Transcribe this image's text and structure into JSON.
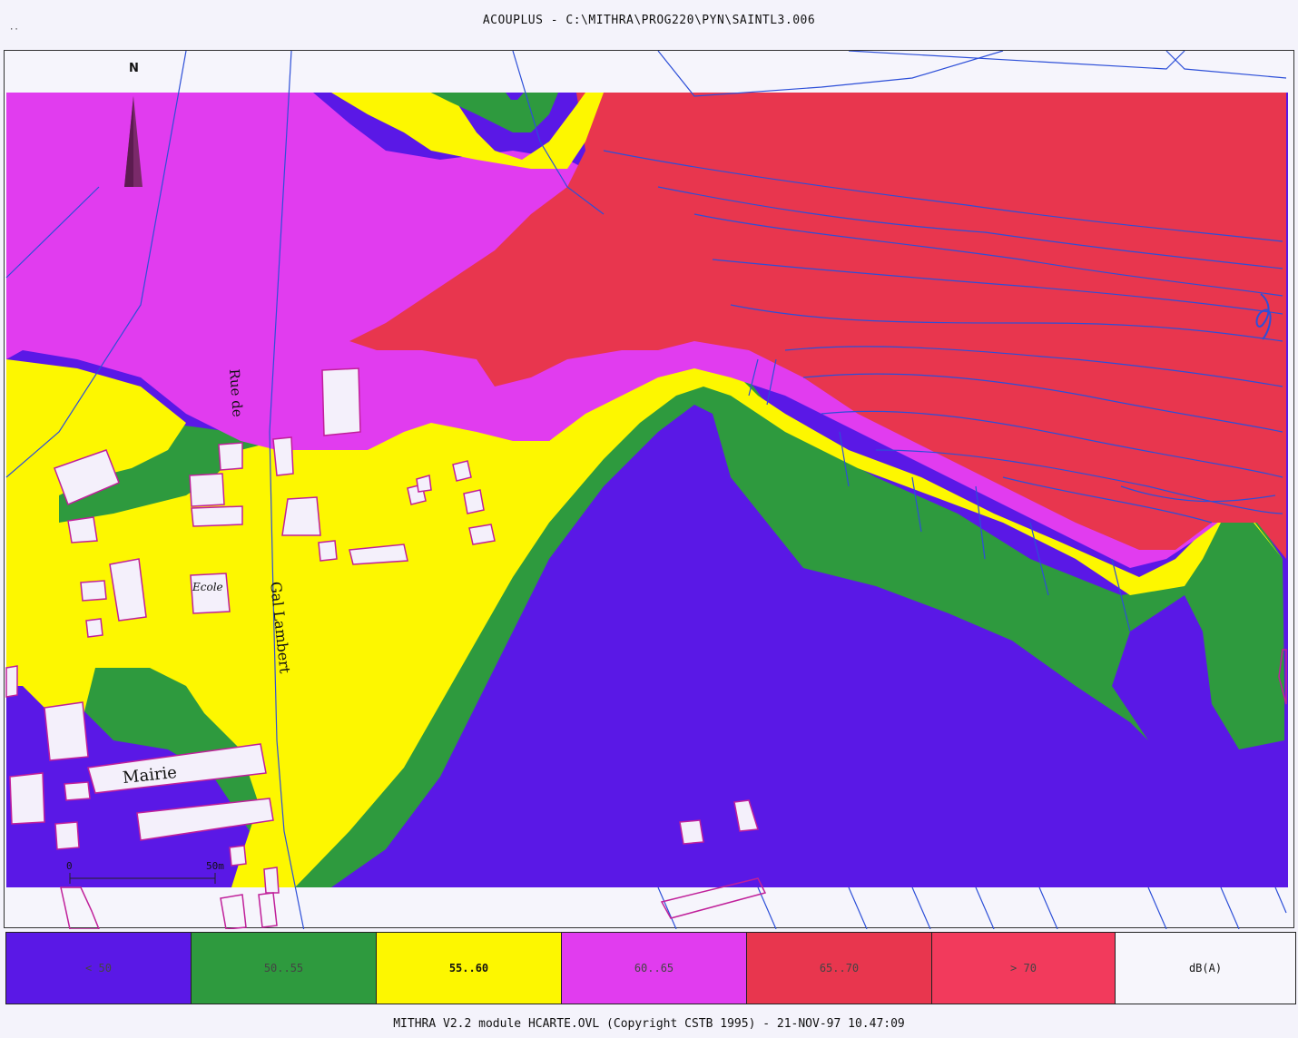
{
  "window": {
    "title": "ACOUPLUS - C:\\MITHRA\\PROG220\\PYN\\SAINTL3.006",
    "menu_glyph": "··"
  },
  "map": {
    "north_label": "N",
    "labels": {
      "rue": "Rue de",
      "street": "Gal Lambert",
      "ecole": "Ecole",
      "mairie": "Mairie"
    },
    "scale": {
      "start": "0",
      "end": "50m"
    },
    "colors": {
      "lt50": "#5a18e6",
      "b50_55": "#2e9a3e",
      "b55_60": "#fdf700",
      "b60_65": "#e13cef",
      "b65_70": "#e8364e",
      "gt70": "#f23a5c",
      "contour": "#2d4fd8",
      "building_edge": "#c0209a"
    }
  },
  "legend": {
    "items": [
      {
        "label": "< 50",
        "color": "#5a18e6"
      },
      {
        "label": "50..55",
        "color": "#2e9a3e"
      },
      {
        "label": "55..60",
        "color": "#fdf700"
      },
      {
        "label": "60..65",
        "color": "#e13cef"
      },
      {
        "label": "65..70",
        "color": "#e8364e"
      },
      {
        "label": "> 70",
        "color": "#f23a5c"
      }
    ],
    "unit": "dB(A)"
  },
  "footer": {
    "text": "MITHRA V2.2 module HCARTE.OVL (Copyright CSTB 1995) - 21-NOV-97 10.47:09"
  }
}
